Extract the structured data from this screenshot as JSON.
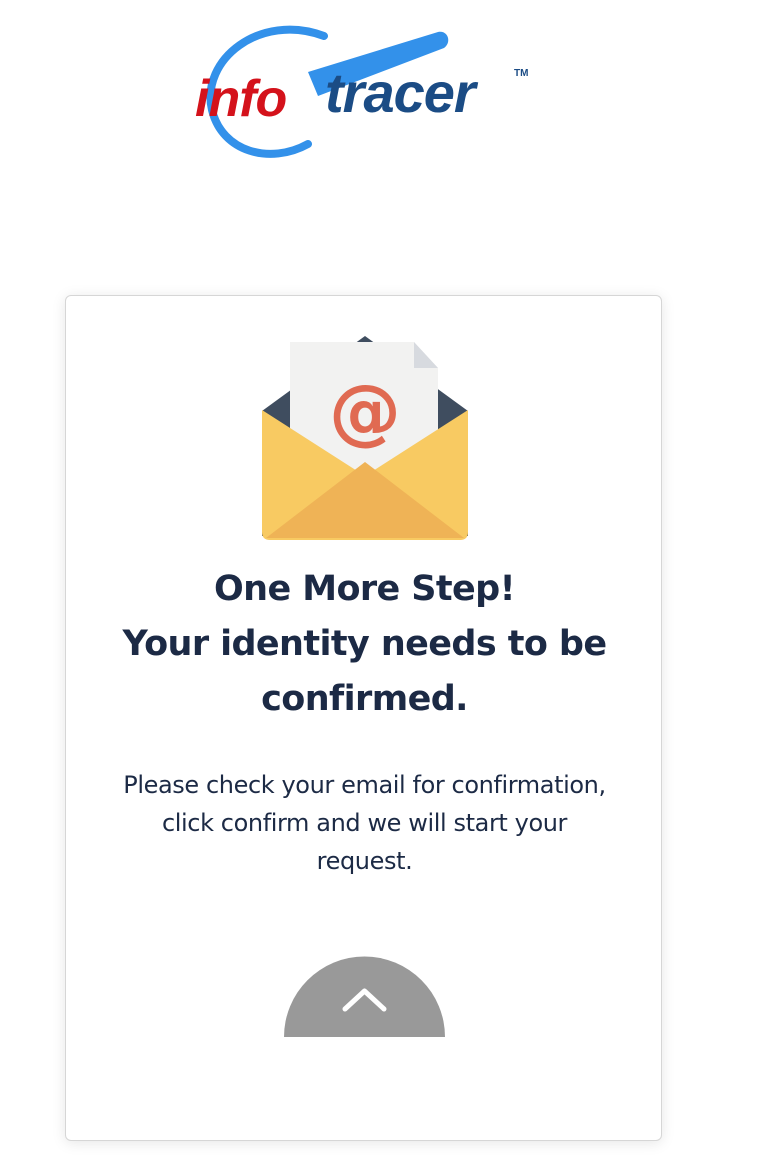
{
  "logo": {
    "text_part1": "info",
    "text_part2": "tracer",
    "trademark": "TM"
  },
  "card": {
    "icon": "email-envelope-icon",
    "heading_lines": [
      "One More Step!",
      "Your identity needs to be",
      "confirmed."
    ],
    "message_lines": [
      "Please check your email for confirmation,",
      "click confirm and we will start your",
      "request."
    ],
    "scroll_button_icon": "chevron-up-icon"
  },
  "colors": {
    "brand_red": "#d4121b",
    "brand_navy": "#1b4c85",
    "brand_blue": "#3391ea",
    "heading_text": "#1c2a45",
    "envelope_body": "#f8ca62",
    "envelope_flap": "#efb356",
    "envelope_back": "#3f4d5f",
    "letter_paper": "#f2f2f1",
    "at_sign": "#e06a52",
    "scroll_button": "#999999"
  }
}
